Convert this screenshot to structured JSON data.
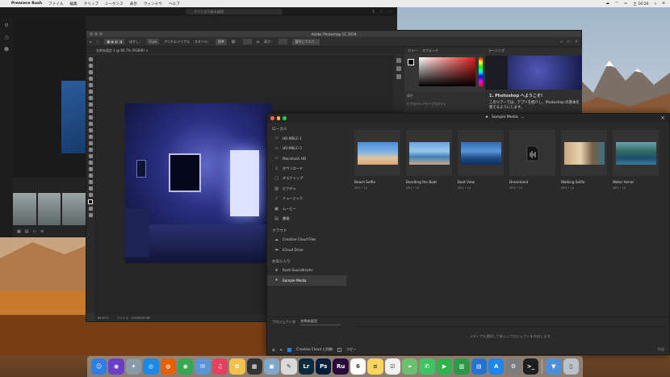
{
  "menubar": {
    "app_name": "Premiere Rush",
    "items": [
      "ファイル",
      "編集",
      "クリップ",
      "シーケンス",
      "表示",
      "ウィンドウ",
      "ヘルプ"
    ],
    "clock": "土 16:20"
  },
  "rush": {
    "search_placeholder": "すべての写真を検索"
  },
  "photoshop": {
    "window_title": "Adobe Photoshop CC 2019",
    "options": {
      "blur_label": "ぼかし：",
      "blur_value": "0 px",
      "antialias": "アンチエイリアス",
      "style_label": "スタイル：",
      "style_value": "標準",
      "width_label": "幅：",
      "height_label": "高さ：",
      "select_mask": "選択とマスク..."
    },
    "doc_tab": "名称未設定 1 @ 66.7% (RGB/8) ×",
    "status": {
      "zoom": "66.67%",
      "file": "ファイル：3.00M/26.9M"
    },
    "color_panel": {
      "tab1": "カラー",
      "tab2": "スウォッチ",
      "props_tab": "属性",
      "props_value": "ピクセルレイヤープロパティ"
    },
    "learn_panel": {
      "tab": "ラーニング",
      "heading": "1. Photoshop へようこそ!",
      "body": "このツアーでは、アプリを紹介し、Photoshop の基本を使えるようにします。"
    }
  },
  "import_dialog": {
    "location": "Sample Media",
    "sections": {
      "local": "ローカル",
      "cloud": "クラウド",
      "favorites": "お気に入り"
    },
    "local_items": [
      {
        "icon": "monitor-icon",
        "label": "HD-MBLC-1"
      },
      {
        "icon": "monitor-icon",
        "label": "HD-MBLC-3"
      },
      {
        "icon": "monitor-icon",
        "label": "Macintosh HD"
      },
      {
        "icon": "download-icon",
        "label": "ダウンロード"
      },
      {
        "icon": "desktop-icon",
        "label": "デスクトップ"
      },
      {
        "icon": "image-icon",
        "label": "ピクチャ"
      },
      {
        "icon": "music-icon",
        "label": "ミュージック"
      },
      {
        "icon": "movie-icon",
        "label": "ムービー"
      },
      {
        "icon": "document-icon",
        "label": "書類"
      }
    ],
    "cloud_items": [
      {
        "icon": "cloud-icon",
        "label": "Creative Cloud Files"
      },
      {
        "icon": "cloud-icon",
        "label": "iCloud Drive"
      }
    ],
    "favorite_items": [
      {
        "icon": "star-icon",
        "label": "Rush Soundtracks"
      },
      {
        "icon": "star-icon",
        "label": "Sample Media",
        "selected": true
      }
    ],
    "media": [
      {
        "name": "Beach Selfie",
        "meta": "MP4 • 20"
      },
      {
        "name": "Boarding the Boat",
        "meta": "MP4 • 20"
      },
      {
        "name": "Boat View",
        "meta": "MP4 • 20"
      },
      {
        "name": "Dreamland",
        "meta": "MP3 • 20"
      },
      {
        "name": "Walking Selfie",
        "meta": "MP4 • 20"
      },
      {
        "name": "Water Aerial",
        "meta": "MP4 • 20"
      }
    ],
    "project_label": "プロジェクト名",
    "project_value": "名称未設定",
    "message": "メディアを選択して新しいプロジェクトを作成します。",
    "sync_label": "Creative Cloud と同期",
    "copy_label": "コピー",
    "create_label": "作成"
  },
  "dock": {
    "apps": [
      {
        "name": "finder",
        "color": "#2f7ee6",
        "glyph": "☺"
      },
      {
        "name": "siri",
        "color": "#6a3fc7",
        "glyph": "◉"
      },
      {
        "name": "launchpad",
        "color": "#8a9aa8",
        "glyph": "✦"
      },
      {
        "name": "safari",
        "color": "#1e88e5",
        "glyph": "◎"
      },
      {
        "name": "firefox",
        "color": "#e66000",
        "glyph": "◍"
      },
      {
        "name": "chrome",
        "color": "#34a853",
        "glyph": "◉"
      },
      {
        "name": "mail",
        "color": "#5c94d6",
        "glyph": "✉"
      },
      {
        "name": "music",
        "color": "#e4405f",
        "glyph": "♫"
      },
      {
        "name": "photos",
        "color": "#f2c14e",
        "glyph": "✿"
      },
      {
        "name": "activity",
        "color": "#333333",
        "glyph": "▦"
      },
      {
        "name": "preview",
        "color": "#7fa7c9",
        "glyph": "▣"
      },
      {
        "name": "textedit",
        "color": "#d9d9d9",
        "glyph": "✎"
      },
      {
        "name": "lightroom",
        "color": "#0b2a3d",
        "glyph": "Lr"
      },
      {
        "name": "photoshop",
        "color": "#061e3e",
        "glyph": "Ps"
      },
      {
        "name": "rush",
        "color": "#2a0a3a",
        "glyph": "Ru"
      },
      {
        "name": "calendar",
        "color": "#ffffff",
        "glyph": "6"
      },
      {
        "name": "notes",
        "color": "#f7d560",
        "glyph": "≡"
      },
      {
        "name": "reminders",
        "color": "#f0f0f0",
        "glyph": "☑"
      },
      {
        "name": "maps",
        "color": "#6cbf6c",
        "glyph": "⌖"
      },
      {
        "name": "messages",
        "color": "#40c463",
        "glyph": "✆"
      },
      {
        "name": "facetime",
        "color": "#2fb34d",
        "glyph": "▶"
      },
      {
        "name": "numbers",
        "color": "#2b9a46",
        "glyph": "▥"
      },
      {
        "name": "keynote",
        "color": "#2373d1",
        "glyph": "▤"
      },
      {
        "name": "appstore",
        "color": "#1c86ee",
        "glyph": "A"
      },
      {
        "name": "settings",
        "color": "#7d7d7d",
        "glyph": "⚙"
      },
      {
        "name": "terminal",
        "color": "#1e1e1e",
        "glyph": ">_"
      },
      {
        "name": "downloads",
        "color": "#4f8ed8",
        "glyph": "▼"
      },
      {
        "name": "trash",
        "color": "#b9c2c8",
        "glyph": "▯"
      }
    ]
  },
  "colors": {
    "accent": "#2680eb",
    "dialog_bg": "#2a2a2a",
    "ps_bg": "#323232"
  }
}
